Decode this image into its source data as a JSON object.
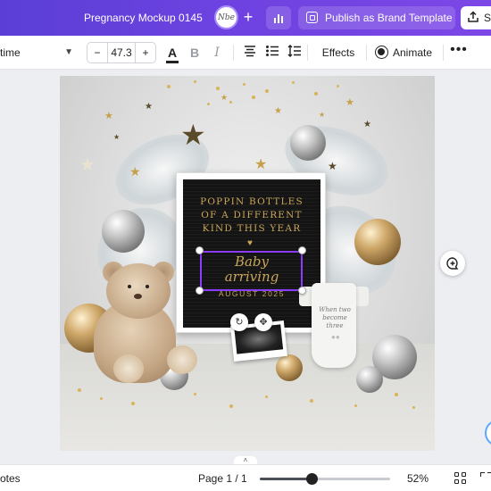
{
  "header": {
    "doc_title": "Pregnancy Mockup 0145",
    "avatar_text": "Nbe",
    "publish_label": "Publish as Brand Template",
    "share_label": "S"
  },
  "toolbar": {
    "font_name": "time",
    "font_size": "47.3",
    "size_minus": "−",
    "size_plus": "+",
    "text_color_glyph": "A",
    "bold_glyph": "B",
    "italic_glyph": "I",
    "effects_label": "Effects",
    "animate_label": "Animate",
    "more_glyph": "•••"
  },
  "canvas": {
    "board_lines": [
      "POPPIN BOTTLES",
      "OF A DIFFERENT",
      "KIND THIS YEAR"
    ],
    "baby_text_1": "Baby",
    "baby_text_2": "arriving",
    "date_text": "AUGUST 2025",
    "onesie_text": "When two become three"
  },
  "bottombar": {
    "notes_label": "otes",
    "page_indicator": "Page 1 / 1",
    "zoom_label": "52%",
    "zoom_value": 0.4
  },
  "colors": {
    "brand_purple": "#6d42e0",
    "selection": "#8b3dff",
    "gold_text": "#c9a55a"
  },
  "icons": [
    "plus-icon",
    "chart-icon",
    "publish-icon",
    "share-icon",
    "chevron-down-icon",
    "text-color-icon",
    "bold-icon",
    "italic-icon",
    "align-center-icon",
    "bullet-list-icon",
    "spacing-icon",
    "animate-icon",
    "more-icon",
    "rotate-icon",
    "move-icon",
    "add-comment-icon",
    "grid-view-icon",
    "fullscreen-icon"
  ]
}
